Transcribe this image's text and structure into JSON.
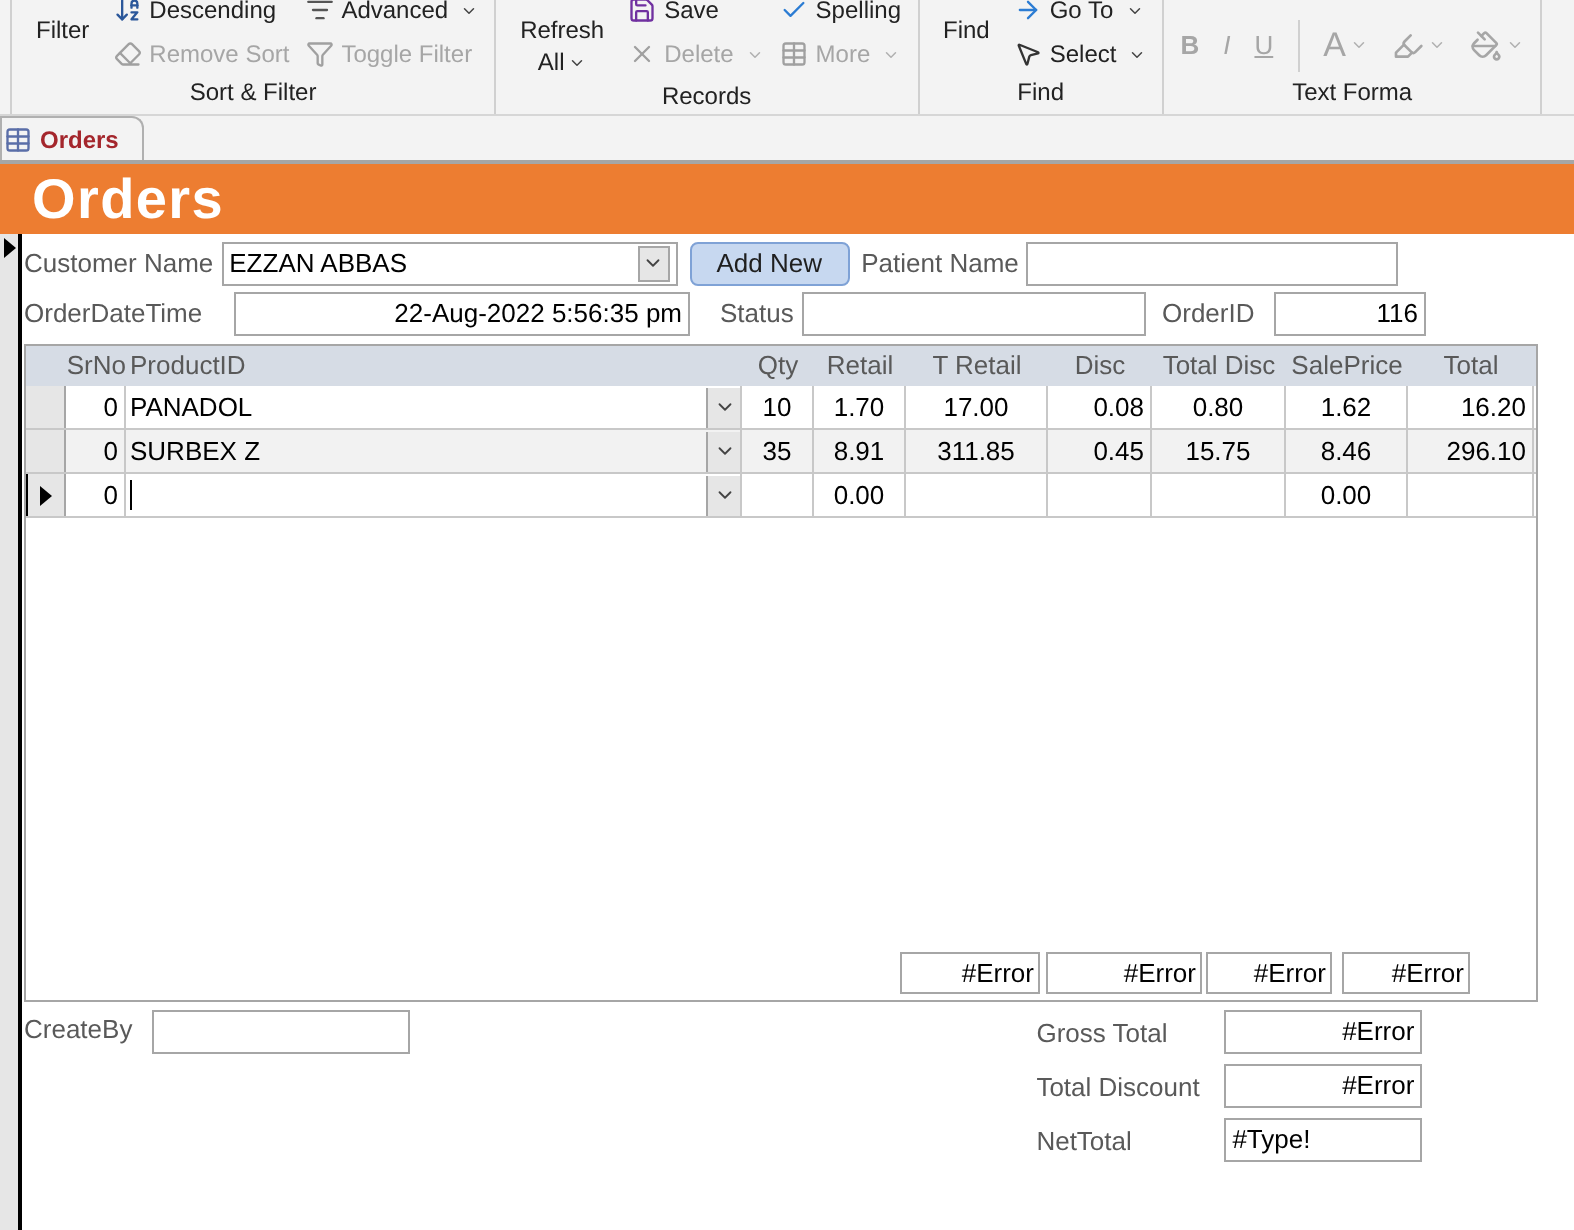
{
  "ribbon": {
    "groups": [
      {
        "label": "Sort & Filter",
        "large": {
          "lines": [
            "Filter"
          ],
          "menu": false
        },
        "columns": [
          [
            {
              "label": "Descending",
              "disabled": false,
              "menu": false
            },
            {
              "label": "Remove Sort",
              "disabled": true,
              "menu": false
            }
          ],
          [
            {
              "label": "Advanced",
              "disabled": false,
              "menu": true
            },
            {
              "label": "Toggle Filter",
              "disabled": true,
              "menu": false
            }
          ]
        ]
      },
      {
        "label": "Records",
        "large": {
          "lines": [
            "Refresh",
            "All"
          ],
          "menu": true
        },
        "columns": [
          [
            {
              "label": "Save",
              "disabled": false,
              "menu": false
            },
            {
              "label": "Delete",
              "disabled": true,
              "menu": true
            }
          ],
          [
            {
              "label": "Spelling",
              "disabled": false,
              "menu": false
            },
            {
              "label": "More",
              "disabled": true,
              "menu": true
            }
          ]
        ]
      },
      {
        "label": "Find",
        "large": {
          "lines": [
            "Find"
          ],
          "menu": false
        },
        "columns": [
          [
            {
              "label": "Go To",
              "disabled": false,
              "menu": true
            },
            {
              "label": "Select",
              "disabled": false,
              "menu": true
            }
          ]
        ]
      },
      {
        "label": "Text Forma",
        "format_buttons": [
          {
            "label": "B",
            "disabled": true,
            "menu": false
          },
          {
            "label": "I",
            "disabled": true,
            "menu": false
          },
          {
            "label": "U",
            "disabled": true,
            "menu": false
          },
          {
            "label": "A",
            "disabled": true,
            "menu": true
          }
        ]
      }
    ]
  },
  "document_tab": {
    "label": "Orders",
    "selected": true
  },
  "form": {
    "title": "Orders",
    "customer": {
      "label": "Customer Name",
      "value": "EZZAN ABBAS"
    },
    "add_button": "Add New",
    "patient": {
      "label": "Patient Name"
    },
    "order_date": {
      "label": "OrderDateTime",
      "value": "22-Aug-2022 5:56:35 pm"
    },
    "status": {
      "label": "Status"
    },
    "order_id": {
      "label": "OrderID",
      "value": "116"
    },
    "subform": {
      "columns": [
        "SrNo",
        "ProductID",
        "Qty",
        "Retail",
        "T Retail",
        "Disc",
        "Total Disc",
        "SalePrice",
        "Total"
      ],
      "rows": [
        {
          "current": false,
          "cells": [
            "0",
            "PANADOL",
            "10",
            "1.70",
            "17.00",
            "0.08",
            "0.80",
            "1.62",
            "16.20"
          ]
        },
        {
          "current": false,
          "cells": [
            "0",
            "SURBEX Z",
            "35",
            "8.91",
            "311.85",
            "0.45",
            "15.75",
            "8.46",
            "296.10"
          ]
        },
        {
          "current": true,
          "cells": [
            "0",
            null,
            null,
            "0.00",
            null,
            null,
            null,
            "0.00",
            null
          ]
        }
      ],
      "totals": [
        "#Error",
        "#Error",
        "#Error",
        "#Error"
      ]
    },
    "create_by": {
      "label": "CreateBy"
    },
    "summary": [
      {
        "label": "Gross Total",
        "value": "#Error",
        "kind": "number"
      },
      {
        "label": "Total Discount",
        "value": "#Error",
        "kind": "number"
      },
      {
        "label": "NetTotal",
        "value": "#Type!",
        "kind": "text"
      }
    ]
  }
}
